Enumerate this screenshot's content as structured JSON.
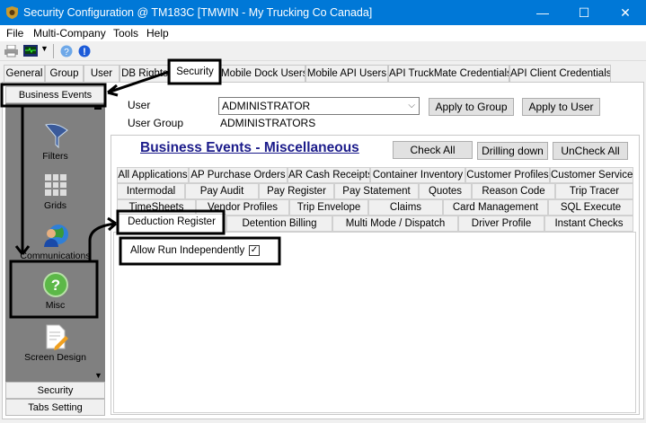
{
  "window": {
    "title": "Security Configuration @ TM183C [TMWIN - My Trucking Co Canada]",
    "minimize": "—",
    "maximize": "☐",
    "close": "✕"
  },
  "menu": [
    "File",
    "Multi-Company",
    "Tools",
    "Help"
  ],
  "toolbar": {
    "icons": [
      "printer-icon",
      "monitor-icon",
      "help-icon",
      "info-icon"
    ]
  },
  "top_tabs": [
    {
      "label": "General"
    },
    {
      "label": "Group"
    },
    {
      "label": "User"
    },
    {
      "label": "DB Rights"
    },
    {
      "label": "Security",
      "selected": true
    },
    {
      "label": "Mobile Dock Users"
    },
    {
      "label": "Mobile API Users"
    },
    {
      "label": "API TruckMate Credentials"
    },
    {
      "label": "API Client Credentials"
    }
  ],
  "sidebar": {
    "header": "Business Events",
    "items": [
      {
        "label": "Filters",
        "icon": "funnel-icon"
      },
      {
        "label": "Grids",
        "icon": "grid-icon"
      },
      {
        "label": "Communications",
        "icon": "globe-user-icon"
      },
      {
        "label": "Misc",
        "icon": "question-icon",
        "selected": true
      },
      {
        "label": "Screen Design",
        "icon": "document-pencil-icon"
      }
    ],
    "footer": [
      "Security",
      "Tabs Setting"
    ]
  },
  "form": {
    "user_label": "User",
    "user_value": "ADMINISTRATOR",
    "group_label": "User Group",
    "group_value": "ADMINISTRATORS",
    "apply_group": "Apply to Group",
    "apply_user": "Apply to User"
  },
  "panel": {
    "title": "Business Events - Miscellaneous",
    "check_all": "Check All",
    "drilling_down": "Drilling down",
    "uncheck_all": "UnCheck All"
  },
  "inner_tabs": [
    [
      "All Applications",
      "AP Purchase Orders",
      "AR Cash Receipts",
      "Container Inventory",
      "Customer Profiles",
      "Customer Service"
    ],
    [
      "Intermodal",
      "Pay Audit",
      "Pay Register",
      "Pay Statement",
      "Quotes",
      "Reason Code",
      "Trip Tracer"
    ],
    [
      "TimeSheets",
      "Vendor Profiles",
      "Trip Envelope",
      "Claims",
      "Card Management",
      "SQL Execute"
    ],
    [
      "Deduction Register",
      "Detention Billing",
      "Multi Mode / Dispatch",
      "Driver Profile",
      "Instant Checks"
    ]
  ],
  "selected_inner_tab": "Deduction Register",
  "option": {
    "label": "Allow Run Independently",
    "checked": true,
    "mark": "✓"
  },
  "colors": {
    "titlebar": "#0078d7",
    "panel_title": "#1b1b8a",
    "sidebar": "#808080"
  }
}
